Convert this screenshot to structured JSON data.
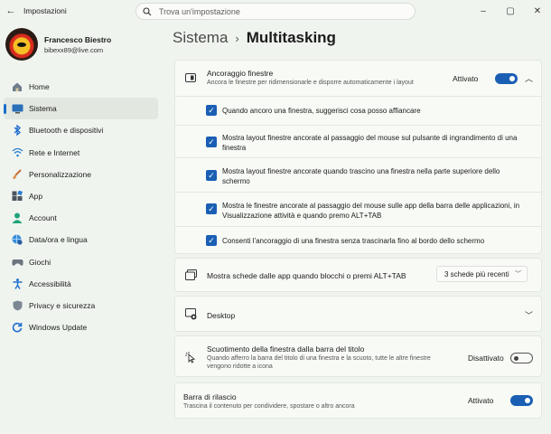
{
  "window": {
    "title": "Impostazioni",
    "search_placeholder": "Trova un'impostazione",
    "controls": [
      "–",
      "▢",
      "✕"
    ]
  },
  "profile": {
    "name": "Francesco Biestro",
    "email": "bibexx89@live.com"
  },
  "sidebar": {
    "items": [
      {
        "label": "Home",
        "icon": "home-icon"
      },
      {
        "label": "Sistema",
        "icon": "system-icon",
        "active": true
      },
      {
        "label": "Bluetooth e dispositivi",
        "icon": "bluetooth-icon"
      },
      {
        "label": "Rete e Internet",
        "icon": "wifi-icon"
      },
      {
        "label": "Personalizzazione",
        "icon": "brush-icon"
      },
      {
        "label": "App",
        "icon": "apps-icon"
      },
      {
        "label": "Account",
        "icon": "account-icon"
      },
      {
        "label": "Data/ora e lingua",
        "icon": "globe-clock-icon"
      },
      {
        "label": "Giochi",
        "icon": "gamepad-icon"
      },
      {
        "label": "Accessibilità",
        "icon": "accessibility-icon"
      },
      {
        "label": "Privacy e sicurezza",
        "icon": "shield-icon"
      },
      {
        "label": "Windows Update",
        "icon": "update-icon"
      }
    ]
  },
  "breadcrumb": {
    "parent": "Sistema",
    "separator": "›",
    "current": "Multitasking"
  },
  "snap": {
    "title": "Ancoraggio finestre",
    "description": "Ancora le finestre per ridimensionarle e disporre automaticamente i layout",
    "state": "Attivato",
    "options": [
      "Quando ancoro una finestra, suggerisci cosa posso affiancare",
      "Mostra layout finestre ancorate al passaggio del mouse sul pulsante di ingrandimento di una finestra",
      "Mostra layout finestre ancorate quando trascino una finestra nella parte superiore dello schermo",
      "Mostra le finestre ancorate al passaggio del mouse sulle app della barra delle applicazioni, in Visualizzazione attività e quando premo ALT+TAB",
      "Consenti l'ancoraggio di una finestra senza trascinarla fino al bordo dello schermo"
    ]
  },
  "alt_tab": {
    "title": "Mostra schede dalle app quando blocchi o premi ALT+TAB",
    "value": "3 schede più recenti"
  },
  "desktop": {
    "title": "Desktop"
  },
  "shake": {
    "title": "Scuotimento della finestra dalla barra del titolo",
    "description": "Quando afferro la barra del titolo di una finestra e la scuoto, tutte le altre finestre vengono ridotte a icona",
    "state": "Disattivato"
  },
  "drag_bar": {
    "title": "Barra di rilascio",
    "description": "Trascina il contenuto per condividere, spostare o altro ancora",
    "state": "Attivato"
  },
  "colors": {
    "accent": "#1a5fb4",
    "background": "#f0f4ef",
    "card": "#f8faf6"
  }
}
